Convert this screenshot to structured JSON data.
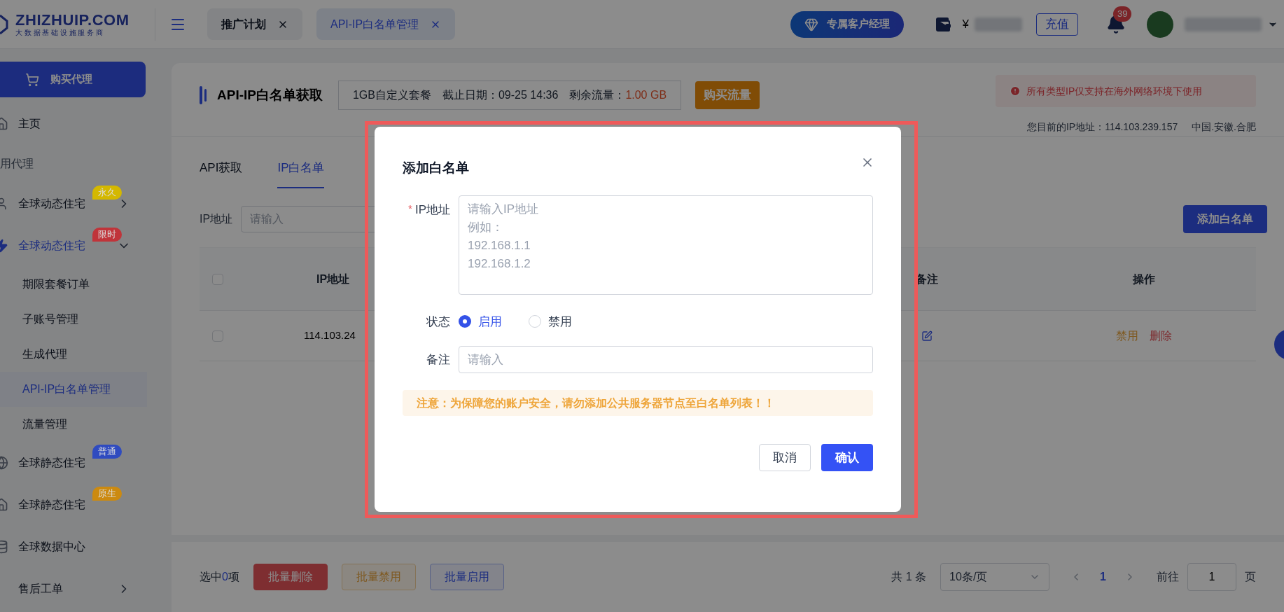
{
  "header": {
    "logo": {
      "name": "ZHIZHUIP.COM",
      "tagline": "大 数 据 基 础 设 施 服 务 商"
    },
    "tabs": [
      {
        "label": "推广计划",
        "selected": false
      },
      {
        "label": "API-IP白名单管理",
        "selected": true
      }
    ],
    "manager_button": "专属客户经理",
    "currency": "¥",
    "recharge_button": "充值",
    "notification_count": "39"
  },
  "sidebar": {
    "buy_button": "购买代理",
    "items": [
      {
        "kind": "item",
        "label": "主页"
      },
      {
        "kind": "section",
        "label": "用代理"
      },
      {
        "kind": "group",
        "label": "全球动态住宅",
        "badge": "永久",
        "color": "#d4b800",
        "expanded": false,
        "selected": false
      },
      {
        "kind": "group",
        "label": "全球动态住宅",
        "badge": "限时",
        "color": "#c0343a",
        "expanded": true,
        "selected": true,
        "children": [
          {
            "label": "期限套餐订单",
            "selected": false
          },
          {
            "label": "子账号管理",
            "selected": false
          },
          {
            "label": "生成代理",
            "selected": false
          },
          {
            "label": "API-IP白名单管理",
            "selected": true
          },
          {
            "label": "流量管理",
            "selected": false
          }
        ]
      },
      {
        "kind": "item",
        "label": "全球静态住宅",
        "badge": "普通",
        "color": "#2f4bc0"
      },
      {
        "kind": "item",
        "label": "全球静态住宅",
        "badge": "原生",
        "color": "#cc8a10"
      },
      {
        "kind": "item",
        "label": "全球数据中心"
      },
      {
        "kind": "group",
        "label": "售后工单",
        "expanded": false,
        "selected": false
      }
    ]
  },
  "page_header": {
    "title": "API-IP白名单获取",
    "plan": "1GB自定义套餐",
    "expiry_label": "截止日期：",
    "expiry": "09-25 14:36",
    "remaining_label": "剩余流量：",
    "remaining": "1.00 GB",
    "buy_traffic_button": "购买流量",
    "notice": "所有类型IP仅支持在海外网络环境下使用",
    "ip_info": "您目前的IP地址：114.103.239.157",
    "location": "中国.安徽.合肥"
  },
  "subtabs": [
    {
      "label": "API获取",
      "selected": false
    },
    {
      "label": "IP白名单",
      "selected": true
    }
  ],
  "filter": {
    "label": "IP地址",
    "placeholder": "请输入",
    "add_button": "添加白名单"
  },
  "table": {
    "select_all_checked": false,
    "columns": [
      "IP地址",
      "备注",
      "操作"
    ],
    "rows": [
      {
        "checked": false,
        "ip": "114.103.24",
        "actions": [
          "禁用",
          "删除"
        ]
      }
    ]
  },
  "bottom_bar": {
    "selected_prefix": "选中",
    "selected_count": "0",
    "selected_suffix": "项",
    "buttons": [
      {
        "kind": "danger",
        "label": "批量删除"
      },
      {
        "kind": "warning",
        "label": "批量禁用"
      },
      {
        "kind": "primary",
        "label": "批量启用"
      }
    ],
    "total": "共 1 条",
    "page_size": "10条/页",
    "pages": [
      {
        "label": "1",
        "selected": true
      }
    ],
    "goto_label": "前往",
    "goto_value": "1",
    "goto_suffix": "页"
  },
  "dialog": {
    "title": "添加白名单",
    "ip_field": {
      "label": "IP地址",
      "required_mark": "*",
      "placeholder_lines": [
        "请输入IP地址",
        "例如：",
        "192.168.1.1",
        "192.168.1.2"
      ]
    },
    "status": {
      "label": "状态",
      "options": [
        {
          "label": "启用",
          "selected": true
        },
        {
          "label": "禁用",
          "selected": false
        }
      ]
    },
    "remark": {
      "label": "备注",
      "placeholder": "请输入"
    },
    "warning": "注意：为保障您的账户安全，请勿添加公共服务器节点至白名单列表！！",
    "cancel_button": "取消",
    "confirm_button": "确认"
  }
}
